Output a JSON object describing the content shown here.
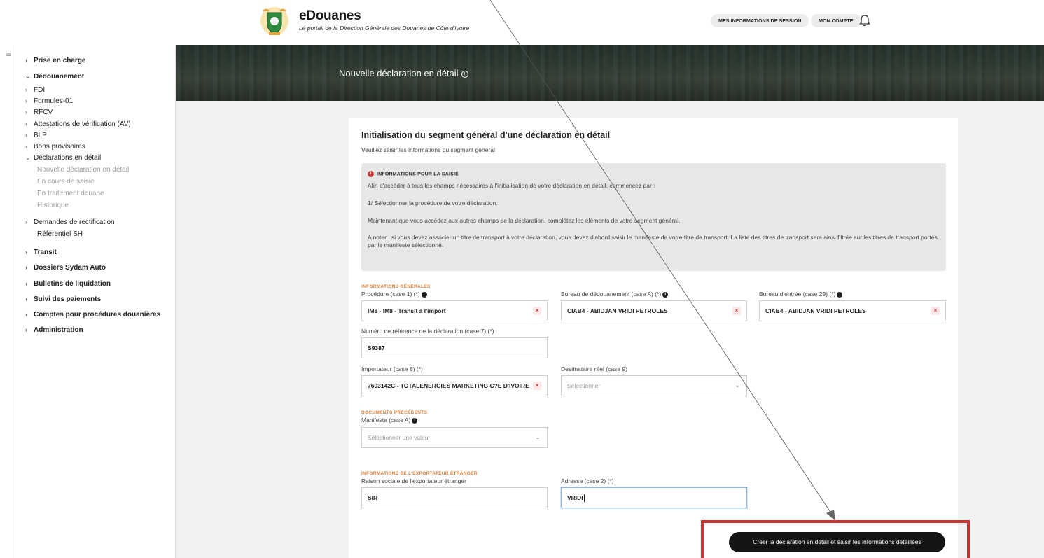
{
  "header": {
    "brand_title": "eDouanes",
    "brand_subtitle": "Le portail de la Direction Générale des Douanes de Côte d'Ivoire",
    "session_label": "MES INFORMATIONS DE SESSION",
    "account_label": "MON COMPTE"
  },
  "sidebar": {
    "items": [
      {
        "label": "Prise en charge",
        "chevron": "›"
      },
      {
        "label": "Dédouanement",
        "chevron": "⌄"
      },
      {
        "label": "FDI",
        "chevron": "›"
      },
      {
        "label": "Formules-01",
        "chevron": "›"
      },
      {
        "label": "RFCV",
        "chevron": "›"
      },
      {
        "label": "Attestations de vérification (AV)",
        "chevron": "›"
      },
      {
        "label": "BLP",
        "chevron": "›"
      },
      {
        "label": "Bons provisoires",
        "chevron": "›"
      },
      {
        "label": "Déclarations en détail",
        "chevron": "⌄"
      },
      {
        "label": "Nouvelle déclaration en détail"
      },
      {
        "label": "En cours de saisie"
      },
      {
        "label": "En traitement douane"
      },
      {
        "label": "Historique"
      },
      {
        "label": "Demandes de rectification",
        "chevron": "›"
      },
      {
        "label": "Référentiel SH"
      },
      {
        "label": "Transit",
        "chevron": "›"
      },
      {
        "label": "Dossiers Sydam Auto",
        "chevron": "›"
      },
      {
        "label": "Bulletins de liquidation",
        "chevron": "›"
      },
      {
        "label": "Suivi des paiements",
        "chevron": "›"
      },
      {
        "label": "Comptes pour procédures douanières",
        "chevron": "›"
      },
      {
        "label": "Administration",
        "chevron": "›"
      }
    ]
  },
  "banner": {
    "title": "Nouvelle déclaration en détail",
    "info_glyph": "i"
  },
  "form": {
    "title": "Initialisation du segment général d'une déclaration en détail",
    "subtitle": "Veuillez saisir les informations du segment général",
    "info": {
      "heading": "INFORMATIONS POUR LA SAISIE",
      "p1": "Afin d'accéder à tous les champs nécessaires à l'initialisation de votre déclaration en détail, commencez par :",
      "p2": "1/ Sélectionner la procédure de votre déclaration.",
      "p3": "Maintenant que vous accédez aux autres champs de la déclaration, complétez les éléments de votre segment général.",
      "p4": "A noter : si vous devez associer un titre de transport à votre déclaration, vous devez d'abord saisir le manifeste de votre titre de transport. La liste des titres de transport sera ainsi filtrée sur les titres de transport portés par le manifeste sélectionné."
    },
    "sections": {
      "general": "INFORMATIONS GÉNÉRALES",
      "previous_docs": "DOCUMENTS PRÉCÉDENTS",
      "exporter": "INFORMATIONS DE L'EXPORTATEUR ÉTRANGER"
    },
    "fields": {
      "procedure": {
        "label": "Procédure (case 1) (*)",
        "value": "IM8 - IM8 - Transit à l'import"
      },
      "bureau_dedouanement": {
        "label": "Bureau de dédouanement (case A) (*)",
        "value": "CIAB4 - ABIDJAN VRIDI PETROLES"
      },
      "bureau_entree": {
        "label": "Bureau d'entrée (case 29) (*)",
        "value": "CIAB4 - ABIDJAN VRIDI PETROLES"
      },
      "numero_reference": {
        "label": "Numéro de référence de la déclaration (case 7) (*)",
        "value": "S9387"
      },
      "importateur": {
        "label": "Importateur (case 8) (*)",
        "value": "7603142C - TOTALENERGIES MARKETING C?E D'IVOIRE"
      },
      "destinataire": {
        "label": "Destinataire réel (case 9)",
        "placeholder": "Sélectionner"
      },
      "manifeste": {
        "label": "Manifeste (case A)",
        "placeholder": "Sélectionner une valeur"
      },
      "raison_sociale": {
        "label": "Raison sociale de l'exportateur étranger",
        "value": "SIR"
      },
      "adresse": {
        "label": "Adresse (case 2) (*)",
        "value": "VRIDI"
      }
    },
    "submit_label": "Créer la déclaration en détail et saisir les informations détaillées"
  },
  "icons": {
    "clear": "×",
    "dropdown": "⌄",
    "menu": "≡"
  },
  "colors": {
    "section_accent": "#e07a2e",
    "submit_bg": "#141414",
    "highlight": "#cc3333"
  }
}
